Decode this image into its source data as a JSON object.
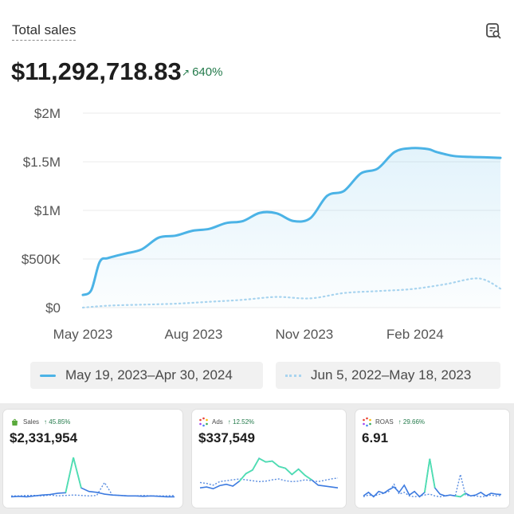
{
  "header": {
    "title": "Total sales",
    "value": "$11,292,718.83",
    "delta": "640%"
  },
  "colors": {
    "current": "#4bb3e6",
    "previous": "#a8d4ef",
    "positive": "#237a4b",
    "spark_current": "#3d7be0",
    "spark_previous": "#5a8de0",
    "spark_highlight": "#4fe0b0"
  },
  "icons": {
    "title_action": "chart-explore-icon",
    "delta": "arrow-up-right-icon",
    "sales": "shop-bag-icon",
    "ads": "ads-multicolor-icon",
    "roas": "roas-multicolor-icon"
  },
  "chart_data": [
    {
      "type": "area",
      "title": "Total sales",
      "y_ticks": [
        "$2M",
        "$1.5M",
        "$1M",
        "$500K",
        "$0"
      ],
      "y_tick_values": [
        2000000,
        1500000,
        1000000,
        500000,
        0
      ],
      "x_ticks": [
        "May 2023",
        "Aug 2023",
        "Nov 2023",
        "Feb 2024"
      ],
      "ylim": [
        0,
        2000000
      ],
      "grid": true,
      "legend_position": "bottom",
      "series": [
        {
          "name": "May 19, 2023–Apr 30, 2024",
          "style": "solid",
          "x": [
            "2023-05-19",
            "2023-05-26",
            "2023-06-02",
            "2023-06-09",
            "2023-06-23",
            "2023-07-07",
            "2023-07-21",
            "2023-08-04",
            "2023-08-18",
            "2023-09-01",
            "2023-09-15",
            "2023-09-29",
            "2023-10-13",
            "2023-10-27",
            "2023-11-10",
            "2023-11-24",
            "2023-12-08",
            "2023-12-22",
            "2024-01-05",
            "2024-01-19",
            "2024-02-02",
            "2024-02-16",
            "2024-03-01",
            "2024-03-08",
            "2024-03-22",
            "2024-04-05",
            "2024-04-19",
            "2024-04-30"
          ],
          "y": [
            130000,
            180000,
            470000,
            510000,
            555000,
            600000,
            720000,
            740000,
            790000,
            810000,
            870000,
            890000,
            975000,
            970000,
            890000,
            920000,
            1150000,
            1200000,
            1380000,
            1430000,
            1600000,
            1640000,
            1630000,
            1600000,
            1560000,
            1550000,
            1545000,
            1540000
          ]
        },
        {
          "name": "Jun 5, 2022–May 18, 2023",
          "style": "dotted",
          "x": [
            "2023-05-19",
            "2023-06-09",
            "2023-07-07",
            "2023-08-04",
            "2023-09-01",
            "2023-09-29",
            "2023-10-27",
            "2023-11-24",
            "2023-12-22",
            "2024-01-19",
            "2024-02-16",
            "2024-03-15",
            "2024-04-12",
            "2024-04-30"
          ],
          "y": [
            0,
            20000,
            30000,
            40000,
            60000,
            80000,
            110000,
            95000,
            150000,
            170000,
            190000,
            240000,
            300000,
            195000
          ]
        }
      ]
    },
    {
      "type": "line",
      "title": "Sales",
      "value": "$2,331,954",
      "delta": "45.85%",
      "series": [
        {
          "name": "current",
          "y": [
            0.1,
            0.11,
            0.1,
            0.12,
            0.14,
            0.15,
            0.18,
            0.19,
            0.98,
            0.3,
            0.22,
            0.2,
            0.16,
            0.14,
            0.13,
            0.12,
            0.12,
            0.11,
            0.12,
            0.11,
            0.1,
            0.1
          ]
        },
        {
          "name": "previous",
          "y": [
            0.12,
            0.12,
            0.13,
            0.13,
            0.12,
            0.14,
            0.12,
            0.13,
            0.14,
            0.13,
            0.12,
            0.13,
            0.42,
            0.14,
            0.13,
            0.12,
            0.12,
            0.13,
            0.12,
            0.12,
            0.12,
            0.13
          ]
        }
      ],
      "highlight_index": 8
    },
    {
      "type": "line",
      "title": "Ads",
      "value": "$337,549",
      "delta": "12.52%",
      "series": [
        {
          "name": "current",
          "y": [
            0.3,
            0.32,
            0.28,
            0.35,
            0.38,
            0.34,
            0.45,
            0.62,
            0.7,
            0.96,
            0.88,
            0.9,
            0.78,
            0.74,
            0.6,
            0.72,
            0.58,
            0.48,
            0.36,
            0.34,
            0.32,
            0.3
          ]
        },
        {
          "name": "previous",
          "y": [
            0.42,
            0.4,
            0.36,
            0.44,
            0.46,
            0.48,
            0.5,
            0.48,
            0.46,
            0.44,
            0.45,
            0.48,
            0.5,
            0.46,
            0.44,
            0.45,
            0.48,
            0.46,
            0.44,
            0.47,
            0.5,
            0.52
          ]
        }
      ],
      "highlight_range": [
        6,
        17
      ]
    },
    {
      "type": "line",
      "title": "ROAS",
      "value": "6.91",
      "delta": "29.66%",
      "series": [
        {
          "name": "current",
          "y": [
            0.12,
            0.2,
            0.1,
            0.22,
            0.18,
            0.26,
            0.32,
            0.2,
            0.36,
            0.14,
            0.22,
            0.1,
            0.2,
            0.95,
            0.3,
            0.16,
            0.12,
            0.14,
            0.12,
            0.1,
            0.18,
            0.12,
            0.14,
            0.2,
            0.12,
            0.18,
            0.16,
            0.15
          ]
        },
        {
          "name": "previous",
          "y": [
            0.1,
            0.14,
            0.12,
            0.15,
            0.18,
            0.22,
            0.38,
            0.16,
            0.2,
            0.12,
            0.1,
            0.12,
            0.14,
            0.16,
            0.12,
            0.1,
            0.12,
            0.14,
            0.12,
            0.6,
            0.14,
            0.12,
            0.12,
            0.1,
            0.11,
            0.14,
            0.12,
            0.13
          ]
        }
      ],
      "highlight_indices": [
        12,
        13,
        14,
        18,
        19,
        20
      ]
    }
  ]
}
